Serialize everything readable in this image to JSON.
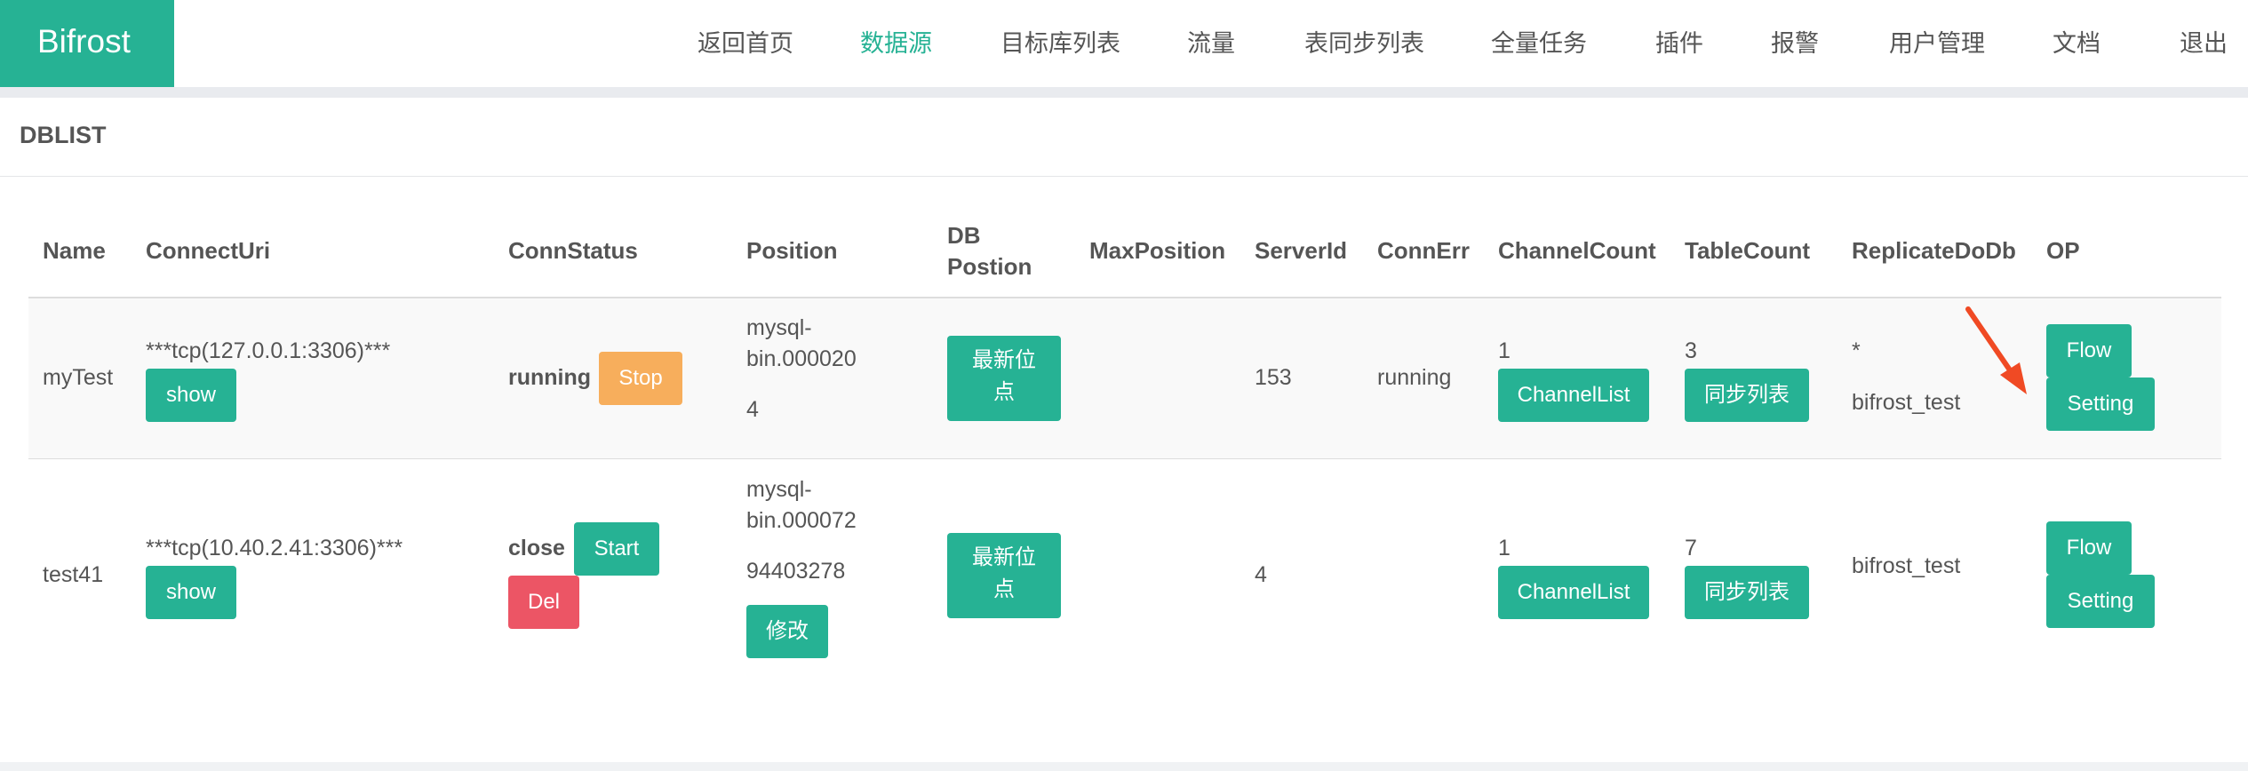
{
  "brand": "Bifrost",
  "nav": [
    {
      "label": "返回首页",
      "active": false
    },
    {
      "label": "数据源",
      "active": true
    },
    {
      "label": "目标库列表",
      "active": false
    },
    {
      "label": "流量",
      "active": false
    },
    {
      "label": "表同步列表",
      "active": false
    },
    {
      "label": "全量任务",
      "active": false
    },
    {
      "label": "插件",
      "active": false
    },
    {
      "label": "报警",
      "active": false
    },
    {
      "label": "用户管理",
      "active": false
    },
    {
      "label": "文档",
      "active": false
    },
    {
      "label": "退出",
      "active": false
    }
  ],
  "panel": {
    "title": "DBLIST"
  },
  "table": {
    "headers": {
      "name": "Name",
      "connect_uri": "ConnectUri",
      "conn_status": "ConnStatus",
      "position": "Position",
      "db_position_1": "DB",
      "db_position_2": "Postion",
      "max_position": "MaxPosition",
      "server_id": "ServerId",
      "conn_err": "ConnErr",
      "channel_count": "ChannelCount",
      "table_count": "TableCount",
      "replicate_do_db": "ReplicateDoDb",
      "op": "OP"
    },
    "rows": [
      {
        "name": "myTest",
        "connect_uri": "***tcp(127.0.0.1:3306)***",
        "show_label": "show",
        "status": "running",
        "status_button": "Stop",
        "position_file_1": "mysql-",
        "position_file_2": "bin.000020",
        "position_offset": "4",
        "latest_pos_1": "最新位",
        "latest_pos_2": "点",
        "server_id": "153",
        "conn_err": "running",
        "channel_count": "1",
        "channel_list_label": "ChannelList",
        "table_count": "3",
        "sync_list_label": "同步列表",
        "replicate_star": "*",
        "replicate_db": "bifrost_test",
        "flow_label": "Flow",
        "setting_label": "Setting"
      },
      {
        "name": "test41",
        "connect_uri": "***tcp(10.40.2.41:3306)***",
        "show_label": "show",
        "status": "close",
        "status_button": "Start",
        "del_label": "Del",
        "position_file_1": "mysql-",
        "position_file_2": "bin.000072",
        "position_offset": "94403278",
        "modify_label": "修改",
        "latest_pos_1": "最新位",
        "latest_pos_2": "点",
        "server_id": "4",
        "conn_err": "",
        "channel_count": "1",
        "channel_list_label": "ChannelList",
        "table_count": "7",
        "sync_list_label": "同步列表",
        "replicate_db": "bifrost_test",
        "flow_label": "Flow",
        "setting_label": "Setting"
      }
    ]
  },
  "colors": {
    "primary": "#26b294",
    "warning": "#f7ae5c",
    "danger": "#ec5565",
    "annotation_arrow": "#f04a24"
  }
}
